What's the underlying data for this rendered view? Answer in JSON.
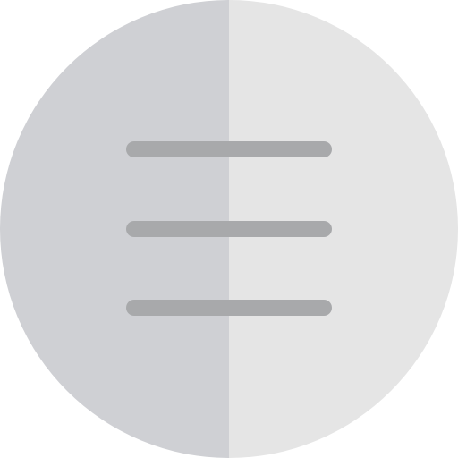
{
  "menu_button": {
    "icon": "hamburger-menu-icon",
    "colors": {
      "left_half": "#CFD0D4",
      "right_half": "#E5E5E5",
      "bars": "#A8A9AB"
    }
  }
}
